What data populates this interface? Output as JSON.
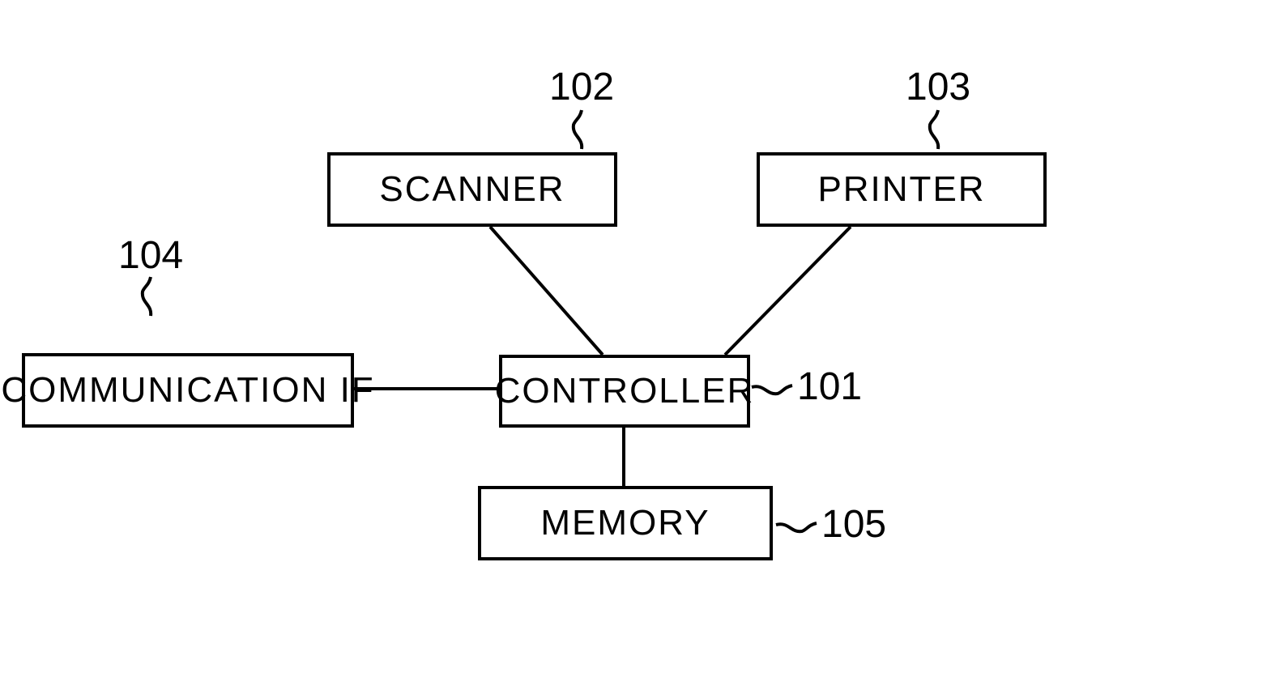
{
  "blocks": {
    "scanner": {
      "label": "SCANNER",
      "ref": "102"
    },
    "printer": {
      "label": "PRINTER",
      "ref": "103"
    },
    "communication": {
      "label": "COMMUNICATION IF",
      "ref": "104"
    },
    "controller": {
      "label": "CONTROLLER",
      "ref": "101"
    },
    "memory": {
      "label": "MEMORY",
      "ref": "105"
    }
  }
}
